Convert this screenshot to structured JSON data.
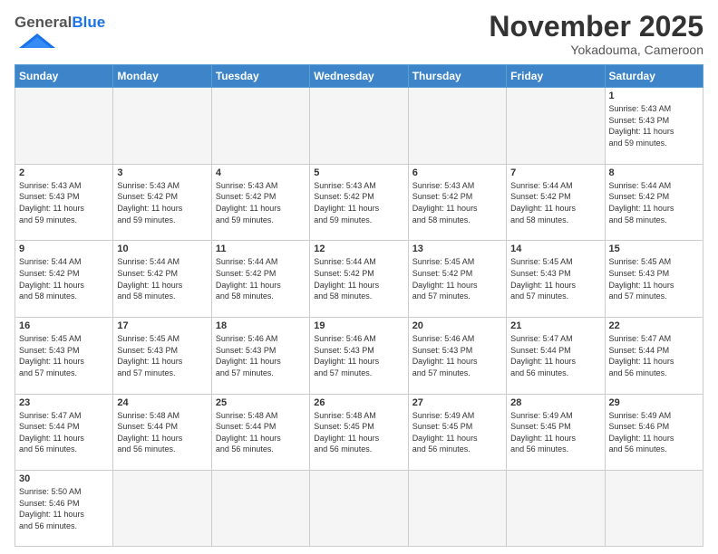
{
  "header": {
    "logo_general": "General",
    "logo_blue": "Blue",
    "month_title": "November 2025",
    "location": "Yokadouma, Cameroon"
  },
  "days_of_week": [
    "Sunday",
    "Monday",
    "Tuesday",
    "Wednesday",
    "Thursday",
    "Friday",
    "Saturday"
  ],
  "weeks": [
    [
      {
        "day": "",
        "info": ""
      },
      {
        "day": "",
        "info": ""
      },
      {
        "day": "",
        "info": ""
      },
      {
        "day": "",
        "info": ""
      },
      {
        "day": "",
        "info": ""
      },
      {
        "day": "",
        "info": ""
      },
      {
        "day": "1",
        "info": "Sunrise: 5:43 AM\nSunset: 5:43 PM\nDaylight: 11 hours\nand 59 minutes."
      }
    ],
    [
      {
        "day": "2",
        "info": "Sunrise: 5:43 AM\nSunset: 5:43 PM\nDaylight: 11 hours\nand 59 minutes."
      },
      {
        "day": "3",
        "info": "Sunrise: 5:43 AM\nSunset: 5:42 PM\nDaylight: 11 hours\nand 59 minutes."
      },
      {
        "day": "4",
        "info": "Sunrise: 5:43 AM\nSunset: 5:42 PM\nDaylight: 11 hours\nand 59 minutes."
      },
      {
        "day": "5",
        "info": "Sunrise: 5:43 AM\nSunset: 5:42 PM\nDaylight: 11 hours\nand 59 minutes."
      },
      {
        "day": "6",
        "info": "Sunrise: 5:43 AM\nSunset: 5:42 PM\nDaylight: 11 hours\nand 58 minutes."
      },
      {
        "day": "7",
        "info": "Sunrise: 5:44 AM\nSunset: 5:42 PM\nDaylight: 11 hours\nand 58 minutes."
      },
      {
        "day": "8",
        "info": "Sunrise: 5:44 AM\nSunset: 5:42 PM\nDaylight: 11 hours\nand 58 minutes."
      }
    ],
    [
      {
        "day": "9",
        "info": "Sunrise: 5:44 AM\nSunset: 5:42 PM\nDaylight: 11 hours\nand 58 minutes."
      },
      {
        "day": "10",
        "info": "Sunrise: 5:44 AM\nSunset: 5:42 PM\nDaylight: 11 hours\nand 58 minutes."
      },
      {
        "day": "11",
        "info": "Sunrise: 5:44 AM\nSunset: 5:42 PM\nDaylight: 11 hours\nand 58 minutes."
      },
      {
        "day": "12",
        "info": "Sunrise: 5:44 AM\nSunset: 5:42 PM\nDaylight: 11 hours\nand 58 minutes."
      },
      {
        "day": "13",
        "info": "Sunrise: 5:45 AM\nSunset: 5:42 PM\nDaylight: 11 hours\nand 57 minutes."
      },
      {
        "day": "14",
        "info": "Sunrise: 5:45 AM\nSunset: 5:43 PM\nDaylight: 11 hours\nand 57 minutes."
      },
      {
        "day": "15",
        "info": "Sunrise: 5:45 AM\nSunset: 5:43 PM\nDaylight: 11 hours\nand 57 minutes."
      }
    ],
    [
      {
        "day": "16",
        "info": "Sunrise: 5:45 AM\nSunset: 5:43 PM\nDaylight: 11 hours\nand 57 minutes."
      },
      {
        "day": "17",
        "info": "Sunrise: 5:45 AM\nSunset: 5:43 PM\nDaylight: 11 hours\nand 57 minutes."
      },
      {
        "day": "18",
        "info": "Sunrise: 5:46 AM\nSunset: 5:43 PM\nDaylight: 11 hours\nand 57 minutes."
      },
      {
        "day": "19",
        "info": "Sunrise: 5:46 AM\nSunset: 5:43 PM\nDaylight: 11 hours\nand 57 minutes."
      },
      {
        "day": "20",
        "info": "Sunrise: 5:46 AM\nSunset: 5:43 PM\nDaylight: 11 hours\nand 57 minutes."
      },
      {
        "day": "21",
        "info": "Sunrise: 5:47 AM\nSunset: 5:44 PM\nDaylight: 11 hours\nand 56 minutes."
      },
      {
        "day": "22",
        "info": "Sunrise: 5:47 AM\nSunset: 5:44 PM\nDaylight: 11 hours\nand 56 minutes."
      }
    ],
    [
      {
        "day": "23",
        "info": "Sunrise: 5:47 AM\nSunset: 5:44 PM\nDaylight: 11 hours\nand 56 minutes."
      },
      {
        "day": "24",
        "info": "Sunrise: 5:48 AM\nSunset: 5:44 PM\nDaylight: 11 hours\nand 56 minutes."
      },
      {
        "day": "25",
        "info": "Sunrise: 5:48 AM\nSunset: 5:44 PM\nDaylight: 11 hours\nand 56 minutes."
      },
      {
        "day": "26",
        "info": "Sunrise: 5:48 AM\nSunset: 5:45 PM\nDaylight: 11 hours\nand 56 minutes."
      },
      {
        "day": "27",
        "info": "Sunrise: 5:49 AM\nSunset: 5:45 PM\nDaylight: 11 hours\nand 56 minutes."
      },
      {
        "day": "28",
        "info": "Sunrise: 5:49 AM\nSunset: 5:45 PM\nDaylight: 11 hours\nand 56 minutes."
      },
      {
        "day": "29",
        "info": "Sunrise: 5:49 AM\nSunset: 5:46 PM\nDaylight: 11 hours\nand 56 minutes."
      }
    ],
    [
      {
        "day": "30",
        "info": "Sunrise: 5:50 AM\nSunset: 5:46 PM\nDaylight: 11 hours\nand 56 minutes."
      },
      {
        "day": "",
        "info": ""
      },
      {
        "day": "",
        "info": ""
      },
      {
        "day": "",
        "info": ""
      },
      {
        "day": "",
        "info": ""
      },
      {
        "day": "",
        "info": ""
      },
      {
        "day": "",
        "info": ""
      }
    ]
  ]
}
